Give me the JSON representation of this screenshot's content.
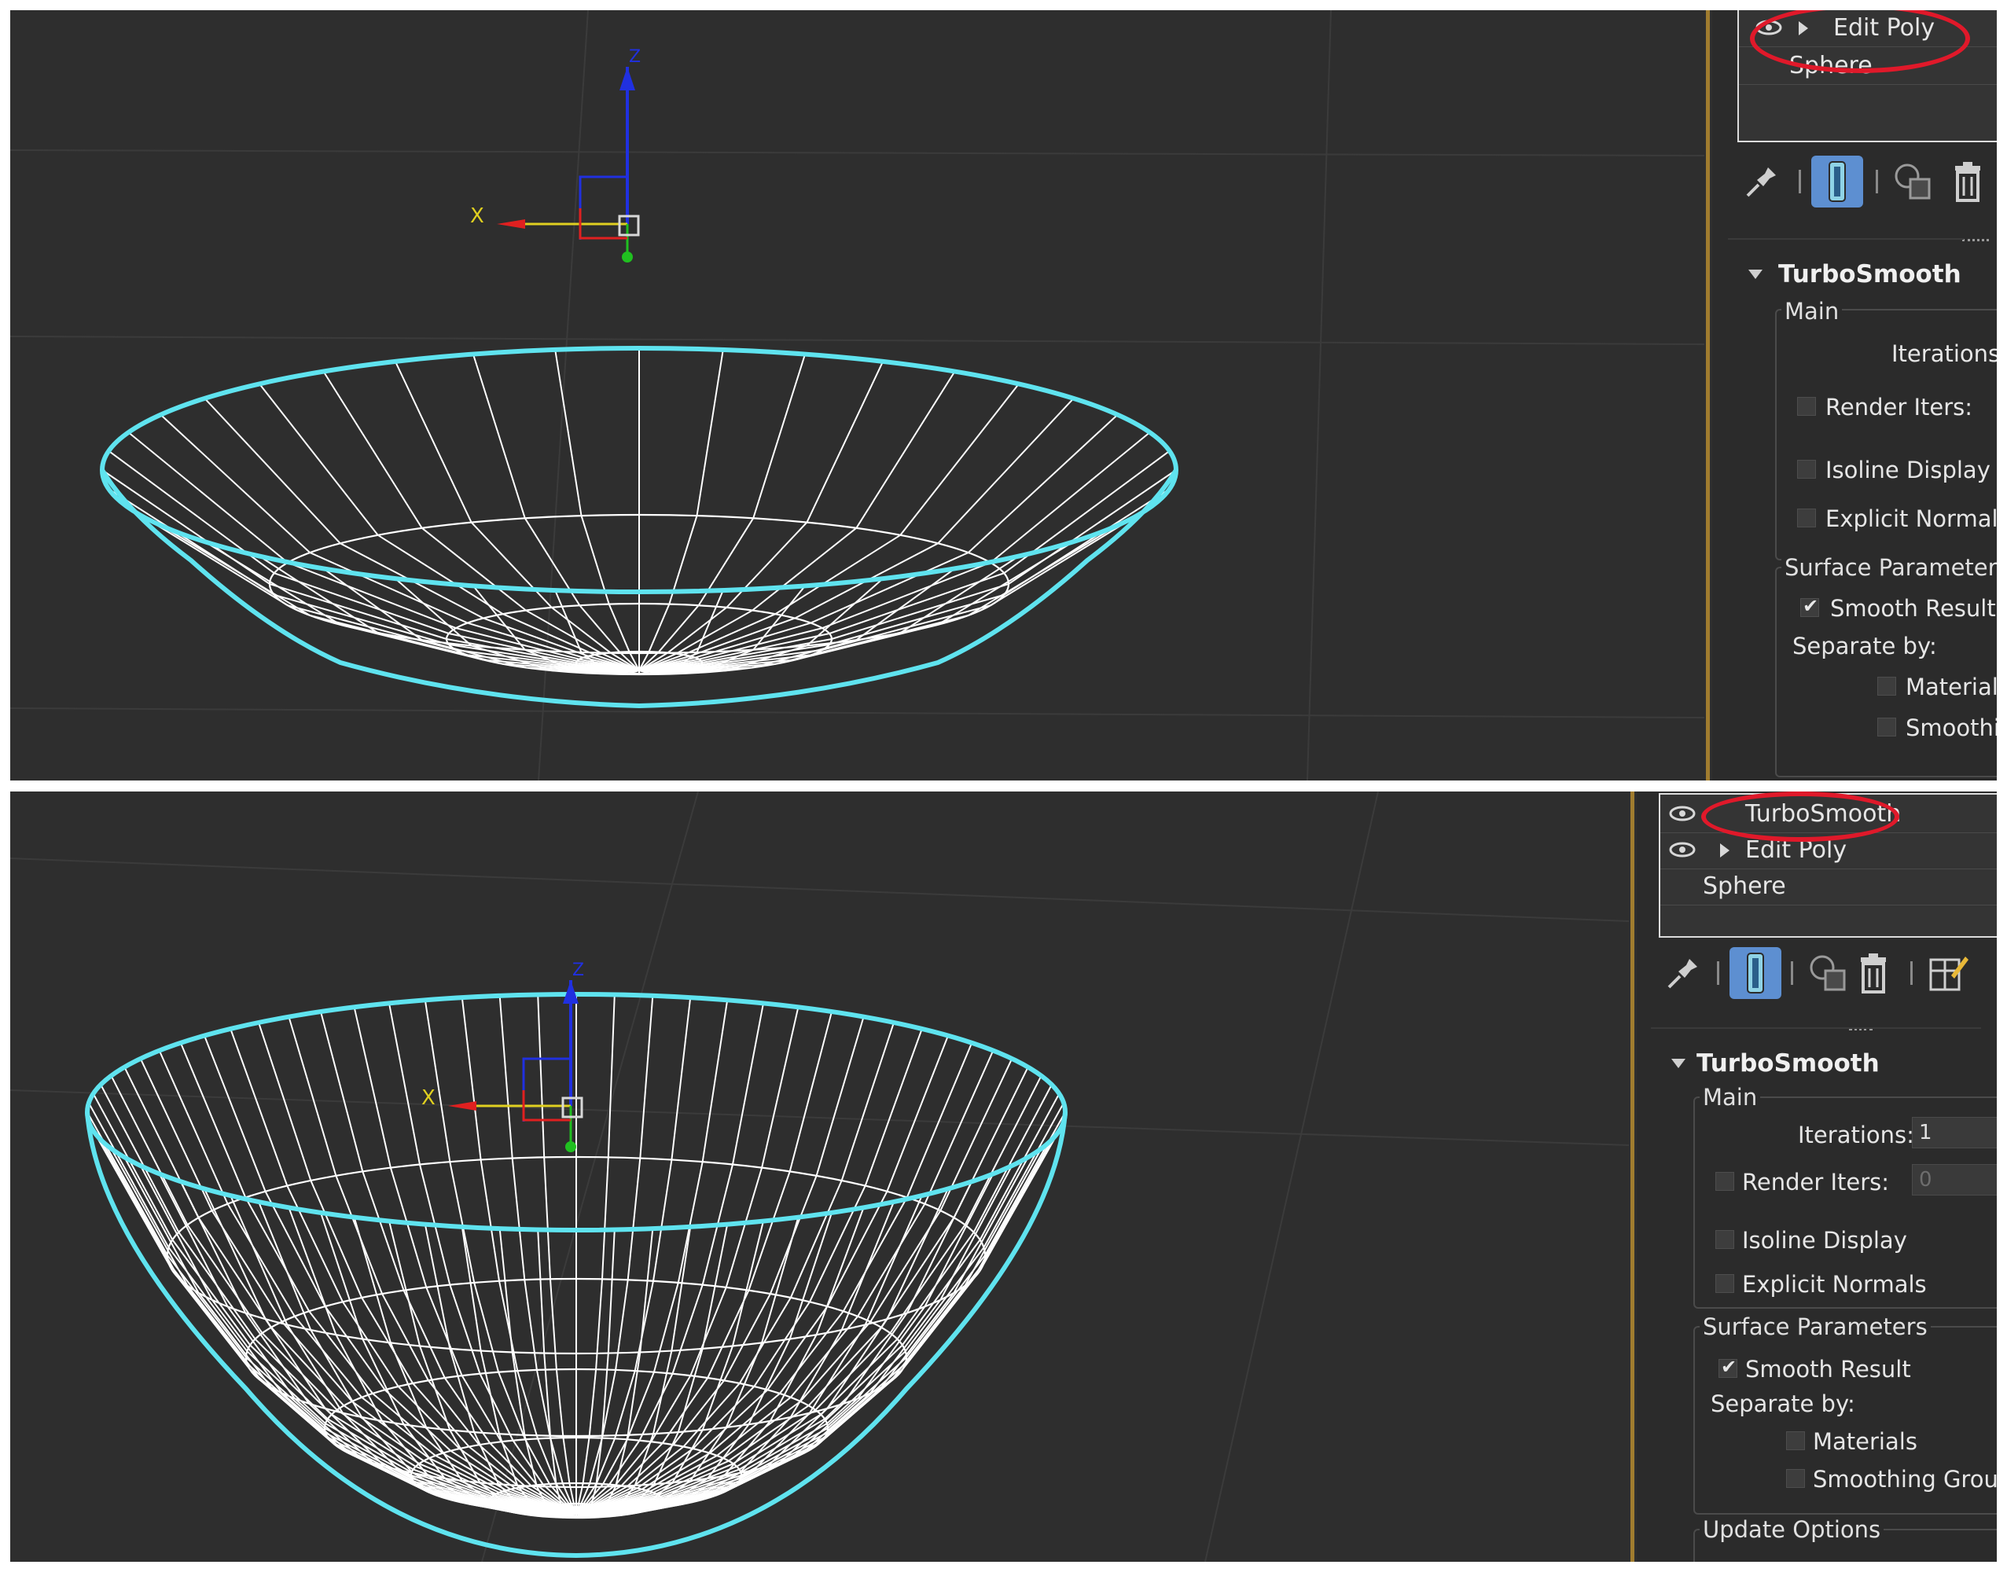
{
  "top": {
    "modifier_stack": [
      {
        "label": "Edit Poly",
        "has_eye": true,
        "expandable": true,
        "highlighted": true
      },
      {
        "label": "Sphere",
        "has_eye": false,
        "expandable": false,
        "highlighted": false
      }
    ],
    "rollout": {
      "title": "TurboSmooth",
      "main_group": "Main",
      "iterations_label": "Iterations:",
      "render_iters_label": "Render Iters:",
      "isoline_label": "Isoline Display",
      "explicit_normals_label": "Explicit Normals",
      "surface_group": "Surface Parameters",
      "smooth_result_label": "Smooth Result",
      "separate_by_label": "Separate by:",
      "materials_label": "Materials",
      "smoothing_label": "Smoothin"
    }
  },
  "bottom": {
    "modifier_stack": [
      {
        "label": "TurboSmooth",
        "has_eye": true,
        "expandable": false,
        "highlighted": true
      },
      {
        "label": "Edit Poly",
        "has_eye": true,
        "expandable": true,
        "highlighted": false
      },
      {
        "label": "Sphere",
        "has_eye": false,
        "expandable": false,
        "highlighted": false
      }
    ],
    "rollout": {
      "title": "TurboSmooth",
      "main_group": "Main",
      "iterations_label": "Iterations:",
      "iterations_value": "1",
      "render_iters_label": "Render Iters:",
      "render_iters_value": "0",
      "isoline_label": "Isoline Display",
      "explicit_normals_label": "Explicit Normals",
      "surface_group": "Surface Parameters",
      "smooth_result_label": "Smooth Result",
      "separate_by_label": "Separate by:",
      "materials_label": "Materials",
      "smoothing_label": "Smoothing Groups",
      "update_group": "Update Options"
    }
  },
  "gizmo": {
    "x_label": "X",
    "z_label": "Z"
  },
  "colors": {
    "viewport_bg": "#2e2e2e",
    "panel_bg": "#2b2b2b",
    "wire": "#ffffff",
    "selection_outline": "#5fe3ef",
    "highlight_ellipse": "#e0192a",
    "active_button": "#5d8fd1",
    "axis_x": "#e02020",
    "axis_y": "#20c020",
    "axis_z": "#2030e0"
  },
  "checkbox_states": {
    "render_iters": false,
    "isoline_display": false,
    "explicit_normals": false,
    "smooth_result": true,
    "materials": false,
    "smoothing_groups": false
  },
  "icons": [
    "eye-icon",
    "expand-triangle-icon",
    "pin-stack-icon",
    "show-end-result-icon",
    "make-unique-icon",
    "remove-modifier-icon",
    "configure-modifier-sets-icon"
  ]
}
